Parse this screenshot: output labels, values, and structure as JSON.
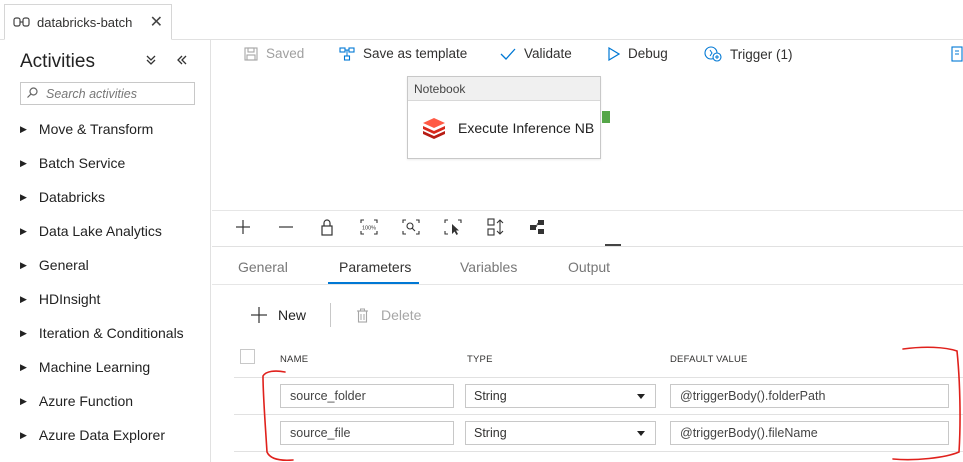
{
  "tab": {
    "title": "databricks-batch"
  },
  "sidebar": {
    "title": "Activities",
    "search_placeholder": "Search activities",
    "categories": [
      "Move & Transform",
      "Batch Service",
      "Databricks",
      "Data Lake Analytics",
      "General",
      "HDInsight",
      "Iteration & Conditionals",
      "Machine Learning",
      "Azure Function",
      "Azure Data Explorer"
    ]
  },
  "toolbar": {
    "saved": "Saved",
    "save_template": "Save as template",
    "validate": "Validate",
    "debug": "Debug",
    "trigger": "Trigger (1)"
  },
  "canvas": {
    "activity": {
      "type": "Notebook",
      "name": "Execute Inference NB"
    }
  },
  "panel": {
    "tabs": [
      "General",
      "Parameters",
      "Variables",
      "Output"
    ],
    "active_tab": "Parameters",
    "new_label": "New",
    "delete_label": "Delete",
    "columns": [
      "NAME",
      "TYPE",
      "DEFAULT VALUE"
    ],
    "rows": [
      {
        "name": "source_folder",
        "type": "String",
        "default": "@triggerBody().folderPath"
      },
      {
        "name": "source_file",
        "type": "String",
        "default": "@triggerBody().fileName"
      }
    ]
  },
  "colors": {
    "accent": "#0078d4",
    "handle": "#55a648",
    "annotation": "#e0211c",
    "databricks": "#e23a2e"
  }
}
